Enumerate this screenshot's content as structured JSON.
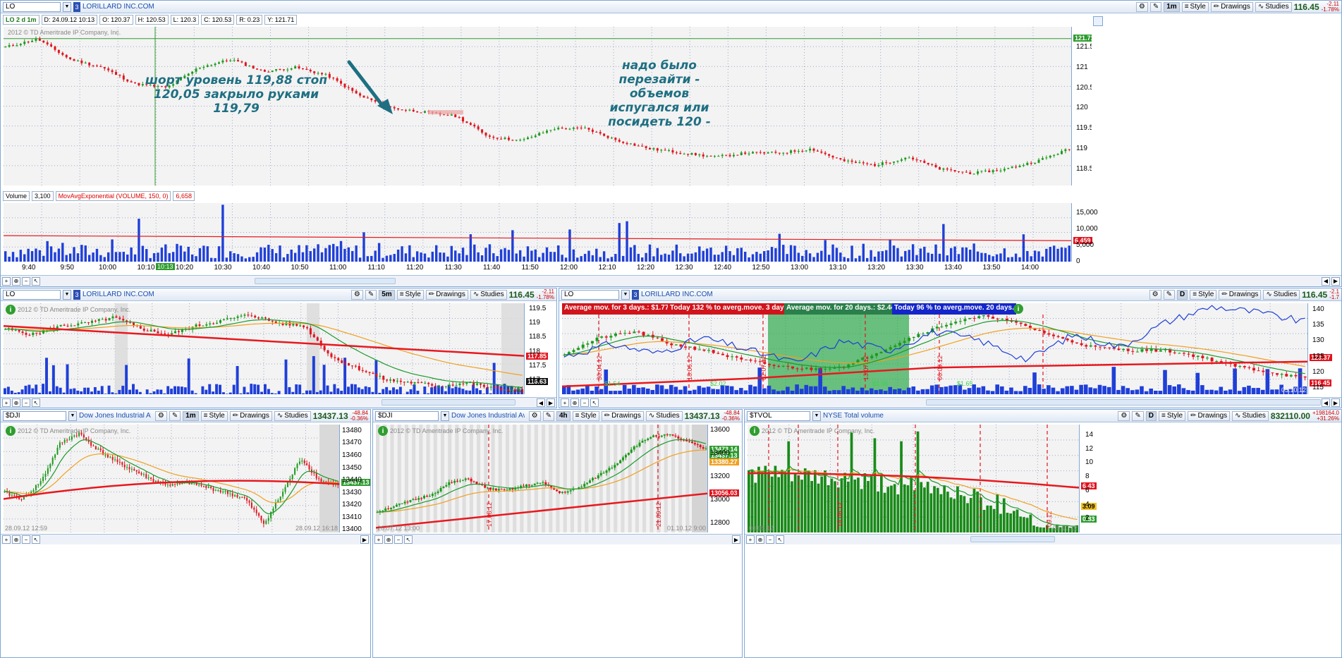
{
  "main": {
    "symbol": "LO",
    "badge": "3",
    "name": "LORILLARD INC.COM",
    "interval": "1m",
    "style_label": "Style",
    "drawings_label": "Drawings",
    "studies_label": "Studies",
    "price": "116.45",
    "chg1": "-2.11",
    "chg2": "-1.78%",
    "quote": {
      "label": "LO 2 d 1m",
      "d": "D: 24.09.12 10:13",
      "o": "O: 120.37",
      "h": "H: 120.53",
      "l": "L: 120.3",
      "c": "C: 120.53",
      "r": "R: 0.23",
      "y": "Y: 121.71"
    },
    "watermark": "2012 © TD Ameritrade IP Company, Inc.",
    "price_tag": "121.71",
    "y_ticks": [
      "121.5",
      "121",
      "120.5",
      "120",
      "119.5",
      "119",
      "118.5"
    ],
    "annotation1": "шорт уровень 119,88 стоп 120,05 закрыло руками 119,79",
    "annotation2": "надо было перезайти - объемов испугался или посидеть 120 -",
    "volume": {
      "label": "Volume",
      "value": "3,100",
      "study": "MovAvgExponential (VOLUME, 150, 0)",
      "study_value": "6,658",
      "y_ticks": [
        "15,000",
        "10,000",
        "5,000",
        "0"
      ],
      "tag": "6,459"
    },
    "x_ticks": [
      "9:40",
      "9:50",
      "10:00",
      "10:10",
      "10:20",
      "10:30",
      "10:40",
      "10:50",
      "11:00",
      "11:10",
      "11:20",
      "11:30",
      "11:40",
      "11:50",
      "12:00",
      "12:10",
      "12:20",
      "12:30",
      "12:40",
      "12:50",
      "13:00",
      "13:10",
      "13:20",
      "13:30",
      "13:40",
      "13:50",
      "14:00"
    ],
    "cursor_time": "10:13"
  },
  "p2": {
    "symbol": "LO",
    "badge": "3",
    "name": "LORILLARD INC.COM",
    "interval": "5m",
    "style_label": "Style",
    "drawings_label": "Drawings",
    "studies_label": "Studies",
    "price": "116.45",
    "chg1": "-2.11",
    "chg2": "-1.78%",
    "watermark": "2012 © TD Ameritrade IP Company, Inc.",
    "y_ticks": [
      "119.5",
      "119",
      "118.5",
      "118",
      "117.5",
      "117"
    ],
    "tag_red": "117.85",
    "tag_black": "116.63",
    "x_note": "17:40"
  },
  "p3": {
    "symbol": "LO",
    "badge": "3",
    "name": "LORILLARD INC.COM",
    "interval": "D",
    "style_label": "Style",
    "drawings_label": "Drawings",
    "studies_label": "Studies",
    "price": "116.45",
    "chg1": "-2.1",
    "chg2": "-1.7",
    "banner1": "Average mov. for 3 days.: $1.77",
    "banner2": "Today 132 % to averg.move. 3 days.",
    "banner3": "Average mov. for 20 days.: $2.44",
    "banner4": "Today 96 % to averg.move. 20 days.",
    "y_ticks": [
      "140",
      "135",
      "130",
      "125",
      "120",
      "115"
    ],
    "tag1": "123.37",
    "tag2": "116.45",
    "dates": [
      "30.04.12",
      "18.06.12",
      "02.07.12",
      "13.07.12",
      "06.09.12"
    ],
    "vals": [
      "$1.54",
      "$2.02",
      "$1.95",
      "$1.65"
    ],
    "x_note": "05.10.12"
  },
  "p4": {
    "symbol": "$DJI",
    "name": "Dow Jones Industrial Av...",
    "interval": "1m",
    "style_label": "Style",
    "drawings_label": "Drawings",
    "studies_label": "Studies",
    "price": "13437.13",
    "chg1": "-48.84",
    "chg2": "-0.36%",
    "watermark": "2012 © TD Ameritrade IP Company, Inc.",
    "y_ticks": [
      "13480",
      "13470",
      "13460",
      "13450",
      "13440",
      "13430",
      "13420",
      "13410",
      "13400"
    ],
    "tag": "13437.13",
    "x_left": "28.09.12 12:59",
    "x_right": "28.09.12 16:18"
  },
  "p5": {
    "symbol": "$DJI",
    "name": "Dow Jones Industrial Av...",
    "interval": "4h",
    "style_label": "Style",
    "drawings_label": "Drawings",
    "studies_label": "Studies",
    "price": "13437.13",
    "chg1": "-48.84",
    "chg2": "-0.36%",
    "watermark": "2012 © TD Ameritrade IP Company, Inc.",
    "y_ticks": [
      "13600",
      "13400",
      "13200",
      "13000",
      "12800"
    ],
    "tag1": "13473.14",
    "tag2": "13437.13",
    "tag3": "13380.27",
    "tag4": "13056.03",
    "dates": [
      "17.08.12",
      "21.09.12"
    ],
    "x_left": "26.07.12 13:00",
    "x_right": "01.10.12 9:00"
  },
  "p6": {
    "symbol": "$TVOL",
    "name": "NYSE Total volume",
    "interval": "D",
    "style_label": "Style",
    "drawings_label": "Drawings",
    "studies_label": "Studies",
    "price": "832110.00",
    "chg1": "+198164.0",
    "chg2": "+31.26%",
    "watermark": "2012 © TD Ameritrade IP Company, Inc.",
    "y_ticks": [
      "14",
      "12",
      "10",
      "8",
      "6",
      "4",
      "2"
    ],
    "tag1": "6.43",
    "tag2": "3.09",
    "tag3": "0.83",
    "dates": [
      "14.08.12",
      "09.12"
    ],
    "x_left": "03.05.12",
    "x_right": "05.10.12"
  },
  "colors": {
    "up": "#1d9a1d",
    "down": "#e0141e",
    "volume": "#1f3fd8",
    "ema_red": "#e8181e",
    "ema_green": "#1a9b2a",
    "ema_orange": "#f0a020",
    "annotation": "#1e6f82",
    "frame": "#7fa7d6"
  }
}
